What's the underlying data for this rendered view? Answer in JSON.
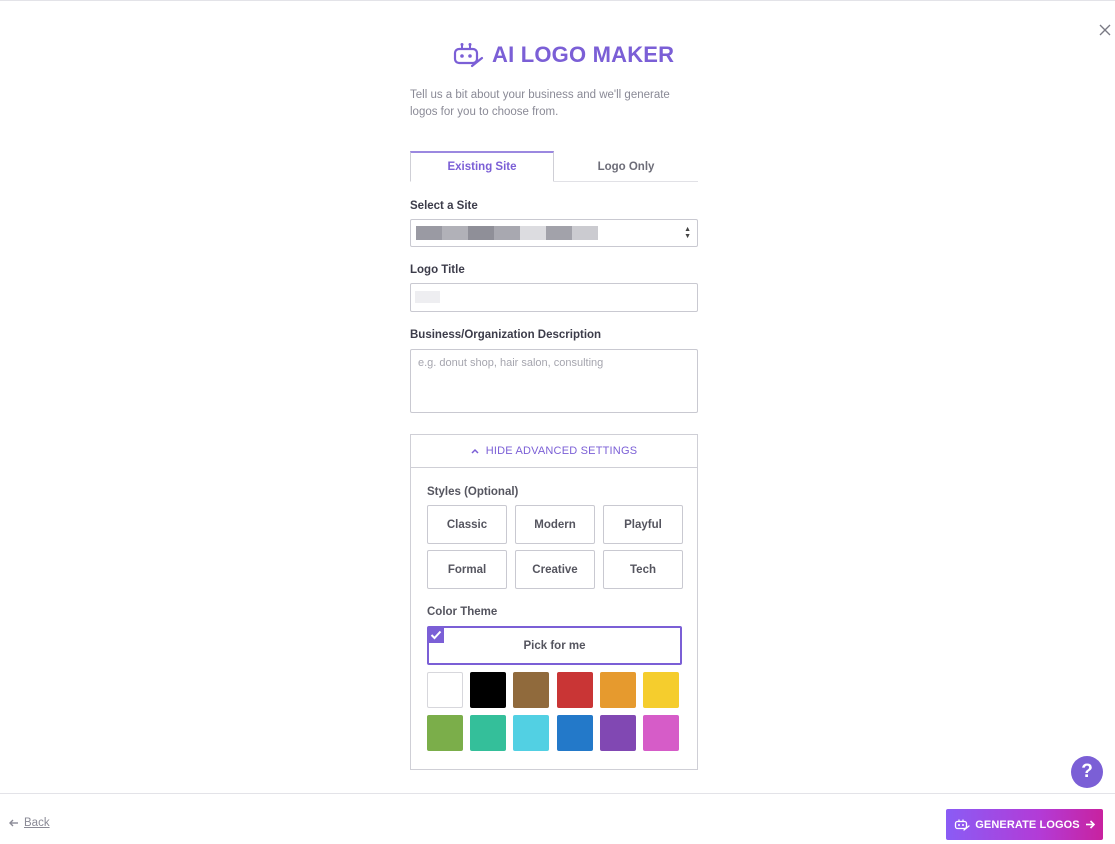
{
  "app": {
    "title": "AI LOGO MAKER",
    "subtitle": "Tell us a bit about your business and we'll generate logos for you to choose from."
  },
  "tabs": [
    {
      "label": "Existing Site",
      "active": true
    },
    {
      "label": "Logo Only",
      "active": false
    }
  ],
  "form": {
    "site_label": "Select a Site",
    "logo_title_label": "Logo Title",
    "description_label": "Business/Organization Description",
    "description_placeholder": "e.g. donut shop, hair salon, consulting"
  },
  "advanced": {
    "toggle_label": "HIDE ADVANCED SETTINGS",
    "styles_label": "Styles (Optional)",
    "styles": [
      "Classic",
      "Modern",
      "Playful",
      "Formal",
      "Creative",
      "Tech"
    ],
    "color_theme_label": "Color Theme",
    "pick_for_me_label": "Pick for me",
    "pick_for_me_checked": true,
    "swatches": [
      {
        "name": "white",
        "hex": "#ffffff"
      },
      {
        "name": "black",
        "hex": "#000000"
      },
      {
        "name": "brown",
        "hex": "#906a3c"
      },
      {
        "name": "red",
        "hex": "#c93535"
      },
      {
        "name": "orange",
        "hex": "#e69a2e"
      },
      {
        "name": "yellow",
        "hex": "#f5cd2d"
      },
      {
        "name": "green",
        "hex": "#7bae4a"
      },
      {
        "name": "teal",
        "hex": "#34bf9a"
      },
      {
        "name": "light-blue",
        "hex": "#52d0e3"
      },
      {
        "name": "blue",
        "hex": "#2379c9"
      },
      {
        "name": "purple",
        "hex": "#8148b3"
      },
      {
        "name": "pink",
        "hex": "#d65cc8"
      }
    ]
  },
  "footer": {
    "back_label": "Back",
    "generate_label": "GENERATE LOGOS"
  },
  "help_label": "?",
  "colors": {
    "accent": "#7b5fd6"
  }
}
